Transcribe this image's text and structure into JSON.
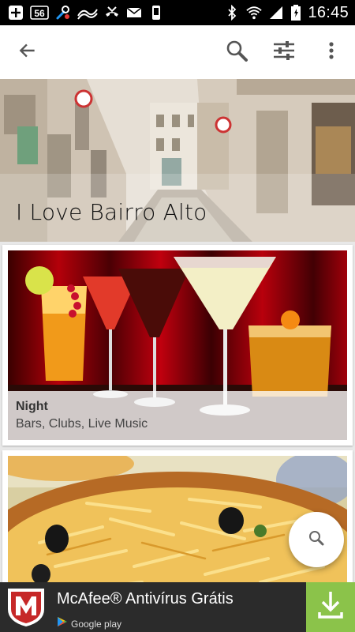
{
  "status_bar": {
    "time": "16:45",
    "badge_56": "56",
    "icons": [
      "plus-icon",
      "badge-56-icon",
      "wrench-icon",
      "signal-wave-icon",
      "missed-call-icon",
      "mail-icon",
      "phone-icon",
      "bluetooth-icon",
      "wifi-icon",
      "cell-signal-icon",
      "battery-icon"
    ]
  },
  "app_bar": {
    "icons": [
      "back-arrow-icon",
      "search-icon",
      "filter-sliders-icon",
      "more-vert-icon"
    ]
  },
  "hero": {
    "title": "I Love Bairro Alto"
  },
  "cards": [
    {
      "title": "Night",
      "subtitle": "Bars, Clubs, Live Music"
    },
    {
      "title": "",
      "subtitle": ""
    }
  ],
  "fab": {
    "icon": "search-icon"
  },
  "ad": {
    "title": "McAfee® Antivírus Grátis",
    "store": "Google play",
    "icon": "download-icon",
    "colors": {
      "background": "#2b2b2b",
      "download": "#8bc34a",
      "logo_red": "#c62828"
    }
  }
}
